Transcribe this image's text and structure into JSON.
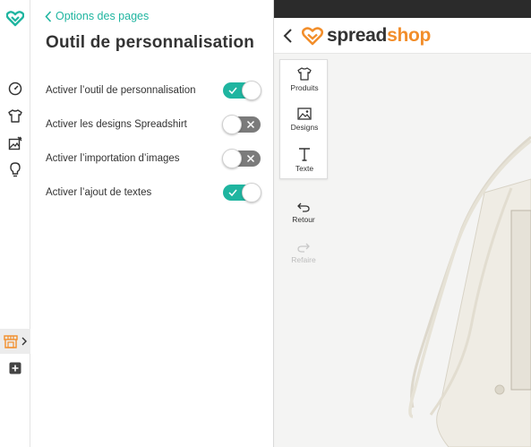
{
  "rail": {
    "icons": [
      "logo-heart-icon",
      "dashboard-gauge-icon",
      "tshirt-icon",
      "image-edit-icon",
      "lightbulb-icon",
      "shop-icon",
      "add-square-icon"
    ]
  },
  "panel": {
    "back_label": "Options des pages",
    "title": "Outil de personnalisation",
    "settings": [
      {
        "label": "Activer l’outil de personnalisation",
        "enabled": true
      },
      {
        "label": "Activer les designs Spreadshirt",
        "enabled": false
      },
      {
        "label": "Activer l’importation d’images",
        "enabled": false
      },
      {
        "label": "Activer l’ajout de textes",
        "enabled": true
      }
    ]
  },
  "preview": {
    "brand_part1": "spread",
    "brand_part2": "shop",
    "tools": [
      {
        "label": "Produits",
        "icon": "tshirt-icon"
      },
      {
        "label": "Designs",
        "icon": "image-icon"
      },
      {
        "label": "Texte",
        "icon": "text-icon"
      }
    ],
    "undo_label": "Retour",
    "redo_label": "Refaire"
  },
  "colors": {
    "accent": "#1fb5a0",
    "brand_orange": "#f28e2b",
    "toggle_off": "#7b7b7b",
    "topbar": "#2b2b2b"
  }
}
